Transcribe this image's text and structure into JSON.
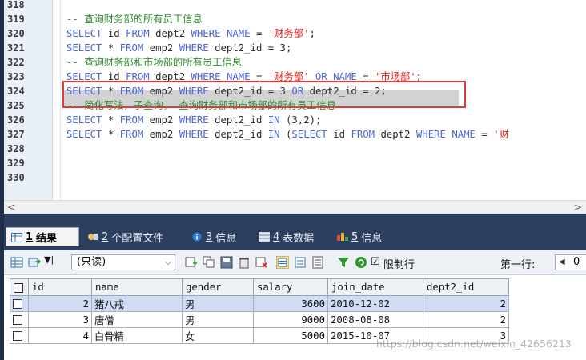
{
  "editor": {
    "line_numbers": [
      "318",
      "319",
      "320",
      "321",
      "322",
      "323",
      "324",
      "325",
      "326",
      "327",
      "328",
      "329",
      "330"
    ],
    "lines": [
      [],
      [
        {
          "t": "-- 查询财务部的所有员工信息",
          "c": "cm"
        }
      ],
      [
        {
          "t": "SELECT",
          "c": "kw"
        },
        {
          "t": " id ",
          "c": ""
        },
        {
          "t": "FROM",
          "c": "kw"
        },
        {
          "t": " dept2 ",
          "c": ""
        },
        {
          "t": "WHERE",
          "c": "kw"
        },
        {
          "t": " ",
          "c": ""
        },
        {
          "t": "NAME",
          "c": "kw"
        },
        {
          "t": " = ",
          "c": ""
        },
        {
          "t": "'财务部'",
          "c": "str"
        },
        {
          "t": ";",
          "c": ""
        }
      ],
      [
        {
          "t": "SELECT",
          "c": "kw"
        },
        {
          "t": " * ",
          "c": ""
        },
        {
          "t": "FROM",
          "c": "kw"
        },
        {
          "t": " emp2 ",
          "c": ""
        },
        {
          "t": "WHERE",
          "c": "kw"
        },
        {
          "t": " dept2_id = 3;",
          "c": ""
        }
      ],
      [
        {
          "t": "-- 查询财务部和市场部的所有员工信息",
          "c": "cm"
        }
      ],
      [
        {
          "t": "SELECT",
          "c": "kw"
        },
        {
          "t": " id ",
          "c": ""
        },
        {
          "t": "FROM",
          "c": "kw"
        },
        {
          "t": " dept2 ",
          "c": ""
        },
        {
          "t": "WHERE",
          "c": "kw"
        },
        {
          "t": " ",
          "c": ""
        },
        {
          "t": "NAME",
          "c": "kw"
        },
        {
          "t": " = ",
          "c": ""
        },
        {
          "t": "'财务部'",
          "c": "str"
        },
        {
          "t": " ",
          "c": ""
        },
        {
          "t": "OR",
          "c": "kw"
        },
        {
          "t": " ",
          "c": ""
        },
        {
          "t": "NAME",
          "c": "kw"
        },
        {
          "t": " = ",
          "c": ""
        },
        {
          "t": "'市场部'",
          "c": "str"
        },
        {
          "t": ";",
          "c": ""
        }
      ],
      [
        {
          "t": "SELECT",
          "c": "kw"
        },
        {
          "t": " * ",
          "c": ""
        },
        {
          "t": "FROM",
          "c": "kw"
        },
        {
          "t": " emp2 ",
          "c": ""
        },
        {
          "t": "WHERE",
          "c": "kw"
        },
        {
          "t": " dept2_id = 3 ",
          "c": ""
        },
        {
          "t": "OR",
          "c": "kw"
        },
        {
          "t": " dept2_id = 2;",
          "c": ""
        }
      ],
      [
        {
          "t": "-- 简化写法，子查询， 查询财务部和市场部的所有员工信息",
          "c": "cm"
        }
      ],
      [
        {
          "t": "SELECT",
          "c": "kw"
        },
        {
          "t": " * ",
          "c": ""
        },
        {
          "t": "FROM",
          "c": "kw"
        },
        {
          "t": " emp2 ",
          "c": ""
        },
        {
          "t": "WHERE",
          "c": "kw"
        },
        {
          "t": " dept2_id ",
          "c": ""
        },
        {
          "t": "IN",
          "c": "kw"
        },
        {
          "t": " (3,2);",
          "c": ""
        }
      ],
      [
        {
          "t": "SELECT",
          "c": "kw"
        },
        {
          "t": " * ",
          "c": ""
        },
        {
          "t": "FROM",
          "c": "kw"
        },
        {
          "t": " emp2 ",
          "c": ""
        },
        {
          "t": "WHERE",
          "c": "kw"
        },
        {
          "t": " dept2_id ",
          "c": ""
        },
        {
          "t": "IN",
          "c": "kw"
        },
        {
          "t": " (",
          "c": ""
        },
        {
          "t": "SELECT",
          "c": "kw"
        },
        {
          "t": " id ",
          "c": ""
        },
        {
          "t": "FROM",
          "c": "kw"
        },
        {
          "t": " dept2 ",
          "c": ""
        },
        {
          "t": "WHERE",
          "c": "kw"
        },
        {
          "t": " ",
          "c": ""
        },
        {
          "t": "NAME",
          "c": "kw"
        },
        {
          "t": " = ",
          "c": ""
        },
        {
          "t": "'财",
          "c": "str"
        }
      ],
      [],
      [],
      []
    ]
  },
  "scroll": {
    "left": "<",
    "right": ">"
  },
  "tabs": [
    {
      "num": "1",
      "label": "结果",
      "icon": "grid-icon",
      "active": true
    },
    {
      "num": "2",
      "label": "个配置文件",
      "icon": "profile-icon",
      "active": false
    },
    {
      "num": "3",
      "label": "信息",
      "icon": "info-icon",
      "active": false
    },
    {
      "num": "4",
      "label": "表数据",
      "icon": "table-icon",
      "active": false
    },
    {
      "num": "5",
      "label": "信息",
      "icon": "info-color-icon",
      "active": false
    }
  ],
  "toolbar": {
    "readonly_value": "(只读)",
    "limit_label": "限制行",
    "first_row_label": "第一行:",
    "first_row_value": "0"
  },
  "grid": {
    "columns": [
      "id",
      "name",
      "gender",
      "salary",
      "join_date",
      "dept2_id"
    ],
    "rows": [
      {
        "id": "2",
        "name": "猪八戒",
        "gender": "男",
        "salary": "3600",
        "join_date": "2010-12-02",
        "dept2_id": "2",
        "selected": true
      },
      {
        "id": "3",
        "name": "唐僧",
        "gender": "男",
        "salary": "9000",
        "join_date": "2008-08-08",
        "dept2_id": "2",
        "selected": false
      },
      {
        "id": "4",
        "name": "白骨精",
        "gender": "女",
        "salary": "5000",
        "join_date": "2015-10-07",
        "dept2_id": "3",
        "selected": false
      }
    ]
  },
  "watermark": "https://blog.csdn.net/weixin_42656213"
}
